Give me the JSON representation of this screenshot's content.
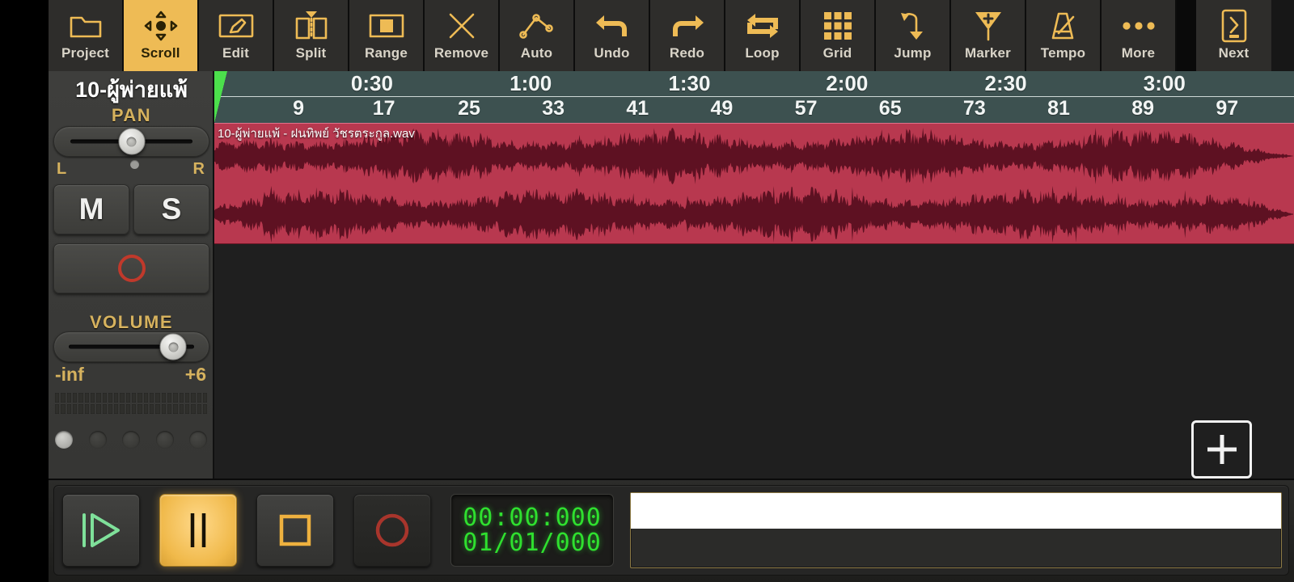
{
  "app": {
    "kind": "mobile-daw-arranger"
  },
  "toolbar": {
    "items": [
      {
        "label": "Project",
        "icon": "folder-icon",
        "active": false
      },
      {
        "label": "Scroll",
        "icon": "scroll-move-icon",
        "active": true
      },
      {
        "label": "Edit",
        "icon": "pencil-icon",
        "active": false
      },
      {
        "label": "Split",
        "icon": "split-icon",
        "active": false
      },
      {
        "label": "Range",
        "icon": "range-select-icon",
        "active": false
      },
      {
        "label": "Remove",
        "icon": "close-x-icon",
        "active": false
      },
      {
        "label": "Auto",
        "icon": "automation-curve-icon",
        "active": false
      },
      {
        "label": "Undo",
        "icon": "undo-arrow-icon",
        "active": false
      },
      {
        "label": "Redo",
        "icon": "redo-arrow-icon",
        "active": false
      },
      {
        "label": "Loop",
        "icon": "loop-repeat-icon",
        "active": false
      },
      {
        "label": "Grid",
        "icon": "grid-icon",
        "active": false
      },
      {
        "label": "Jump",
        "icon": "jump-arrow-icon",
        "active": false
      },
      {
        "label": "Marker",
        "icon": "marker-add-icon",
        "active": false
      },
      {
        "label": "Tempo",
        "icon": "metronome-icon",
        "active": false
      },
      {
        "label": "More",
        "icon": "ellipsis-icon",
        "active": false
      },
      {
        "label": "Next",
        "icon": "next-page-icon",
        "active": false
      }
    ]
  },
  "track": {
    "name": "10-ผู้พ่ายแพ้",
    "pan": {
      "label": "PAN",
      "left": "L",
      "right": "R",
      "position_pct": 50
    },
    "mute_label": "M",
    "solo_label": "S",
    "record_arm": "record-arm",
    "volume": {
      "label": "VOLUME",
      "min": "-inf",
      "max": "+6",
      "position_pct": 77
    },
    "led_count": 5,
    "led_active_index": 0,
    "meter_segments": 26
  },
  "ruler": {
    "time_ticks": [
      {
        "label": "0:30",
        "x_pct": 14.6
      },
      {
        "label": "1:00",
        "x_pct": 29.3
      },
      {
        "label": "1:30",
        "x_pct": 44.0
      },
      {
        "label": "2:00",
        "x_pct": 58.6
      },
      {
        "label": "2:30",
        "x_pct": 73.3
      },
      {
        "label": "3:00",
        "x_pct": 88.0
      }
    ],
    "bar_ticks": [
      {
        "label": "9",
        "x_pct": 7.8
      },
      {
        "label": "17",
        "x_pct": 15.7
      },
      {
        "label": "25",
        "x_pct": 23.6
      },
      {
        "label": "33",
        "x_pct": 31.4
      },
      {
        "label": "41",
        "x_pct": 39.2
      },
      {
        "label": "49",
        "x_pct": 47.0
      },
      {
        "label": "57",
        "x_pct": 54.8
      },
      {
        "label": "65",
        "x_pct": 62.6
      },
      {
        "label": "73",
        "x_pct": 70.4
      },
      {
        "label": "81",
        "x_pct": 78.2
      },
      {
        "label": "89",
        "x_pct": 86.0
      },
      {
        "label": "97",
        "x_pct": 93.8
      }
    ]
  },
  "clip": {
    "title": "10-ผู้พ่ายแพ้ - ฝนทิพย์ วัชรตระกูล.wav",
    "bg_color": "#b8384f",
    "wave_color": "#5e1122"
  },
  "add_track": {
    "label": "+"
  },
  "transport": {
    "play": "play-from-start",
    "pause": "pause",
    "stop": "stop",
    "record": "record",
    "pause_active": true,
    "time_main": "00:00:000",
    "time_bars": "01/01/000"
  },
  "colors": {
    "accent": "#eebb55",
    "ruler_bg": "#3d5150",
    "playhead": "#4ce04c",
    "time_green": "#2fe02f",
    "clip_red": "#b8384f"
  }
}
